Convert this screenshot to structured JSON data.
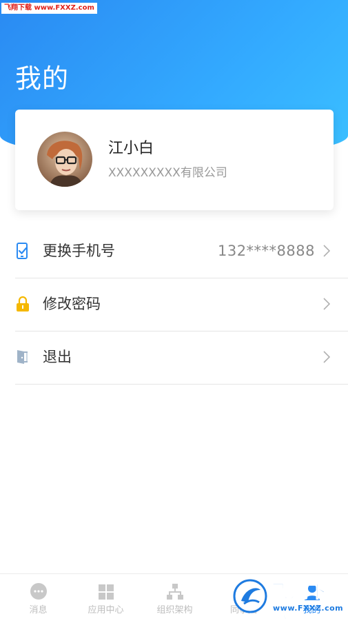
{
  "watermark_top": "飞翔下载 www.FXXZ.com",
  "page_title": "我的",
  "profile": {
    "name": "江小白",
    "company": "XXXXXXXXX有限公司"
  },
  "menu": [
    {
      "label": "更换手机号",
      "value": "132****8888",
      "icon": "phone-check-icon",
      "icon_color": "#2a8af2"
    },
    {
      "label": "修改密码",
      "value": "",
      "icon": "lock-icon",
      "icon_color": "#f5b800"
    },
    {
      "label": "退出",
      "value": "",
      "icon": "exit-door-icon",
      "icon_color": "#9fb3c8"
    }
  ],
  "tabbar": [
    {
      "label": "消息",
      "icon": "chat-bubble-icon",
      "active": false
    },
    {
      "label": "应用中心",
      "icon": "app-grid-icon",
      "active": false
    },
    {
      "label": "组织架构",
      "icon": "org-chart-icon",
      "active": false
    },
    {
      "label": "同事圈",
      "icon": "moments-icon",
      "active": false
    },
    {
      "label": "我的",
      "icon": "person-icon",
      "active": true
    }
  ],
  "watermark_bottom": {
    "brand": "飞翔下载",
    "url": "www.FXXZ.com"
  },
  "colors": {
    "header_gradient_start": "#2a8af2",
    "header_gradient_end": "#3bc0ff",
    "active_tab": "#2a8af2",
    "inactive_tab": "#bdbdbd"
  }
}
